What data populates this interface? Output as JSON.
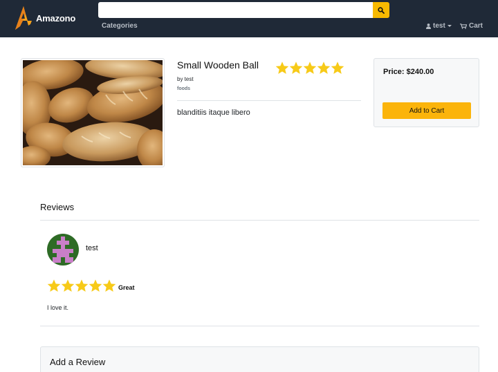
{
  "header": {
    "brand": "Amazono",
    "search": {
      "value": "",
      "placeholder": ""
    },
    "nav": {
      "categories": "Categories",
      "user": "test",
      "cart": "Cart"
    }
  },
  "product": {
    "title": "Small Wooden Ball",
    "rating": 5,
    "rating_max": 5,
    "by": "by test",
    "category": "foods",
    "description": "blanditiis itaque libero",
    "price_label": "Price: $240.00",
    "add_to_cart_label": "Add to Cart",
    "image": "bread-loaves-photo"
  },
  "reviews": {
    "heading": "Reviews",
    "items": [
      {
        "author": "test",
        "rating": 5,
        "rating_max": 5,
        "title": "Great",
        "body": "I love it."
      }
    ]
  },
  "add_review": {
    "heading": "Add a Review"
  },
  "colors": {
    "navbar": "#1f2937",
    "accent": "#f7b900",
    "star": "#f7ca18",
    "avatar_bg": "#2e6b26",
    "avatar_fg": "#c97fc8"
  },
  "icons": {
    "brand": "amazono-logo-icon",
    "search": "search-icon",
    "user": "user-icon",
    "cart": "cart-icon",
    "star": "star-icon"
  }
}
